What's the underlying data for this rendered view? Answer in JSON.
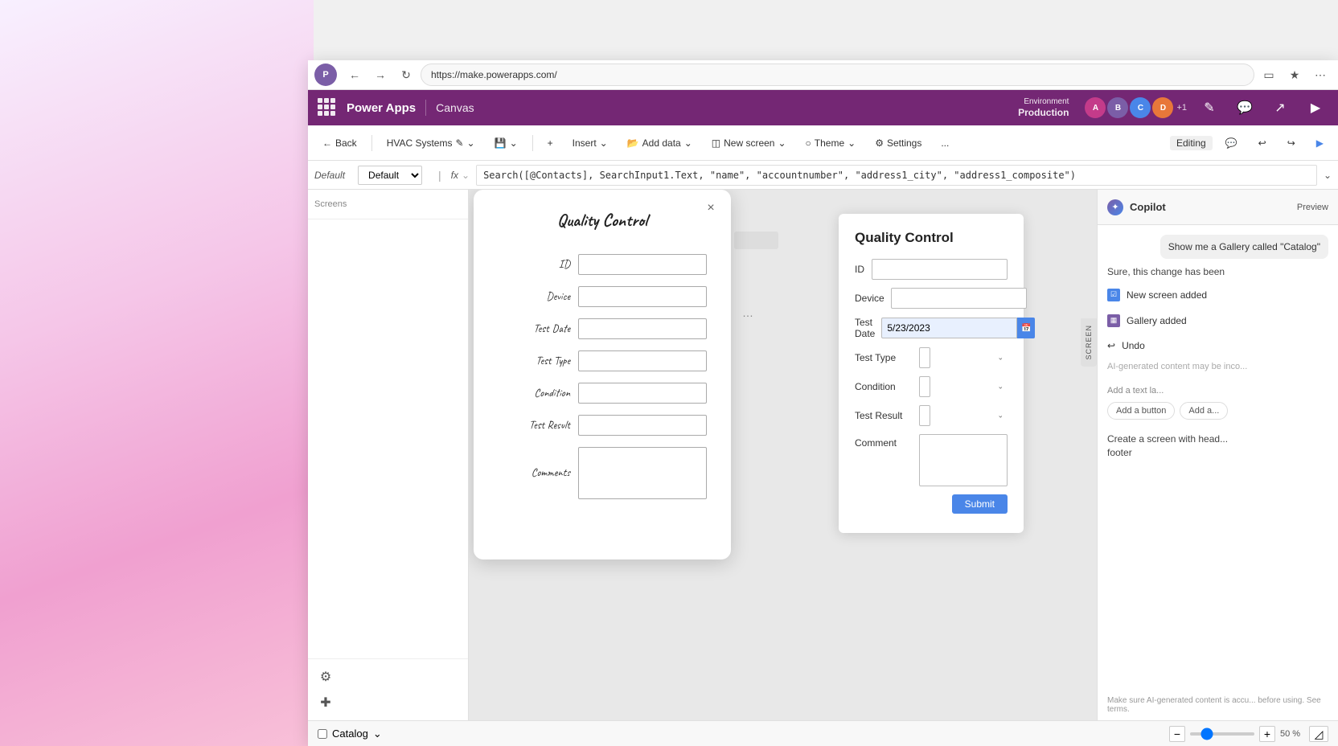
{
  "background": {
    "gradient_description": "pink-purple gradient on left side"
  },
  "browser": {
    "url": "https://make.powerapps.com/"
  },
  "powerapp": {
    "app_name": "Power Apps",
    "section": "Canvas",
    "env_label": "Environment",
    "env_name": "Production"
  },
  "toolbar": {
    "back_label": "Back",
    "app_title": "HVAC Systems",
    "insert_label": "Insert",
    "add_data_label": "Add data",
    "new_screen_label": "New screen",
    "theme_label": "Theme",
    "settings_label": "Settings",
    "more_label": "...",
    "editing_label": "Editing"
  },
  "formula_bar": {
    "fx_label": "fx",
    "formula": "Search([@Contacts], SearchInput1.Text, \"name\", \"accountnumber\", \"address1_city\", \"address1_composite\")"
  },
  "default_dropdown": {
    "value": "Default",
    "options": [
      "Default"
    ]
  },
  "overlay_card": {
    "title": "Quality Control",
    "close_btn": "×",
    "fields": [
      {
        "label": "ID",
        "type": "input"
      },
      {
        "label": "Device",
        "type": "input"
      },
      {
        "label": "Test Date",
        "type": "input"
      },
      {
        "label": "Test Type",
        "type": "input"
      },
      {
        "label": "Condition",
        "type": "input"
      },
      {
        "label": "Test Result",
        "type": "input"
      },
      {
        "label": "Comments",
        "type": "textarea"
      }
    ]
  },
  "qc_card": {
    "title": "Quality Control",
    "fields": [
      {
        "label": "ID",
        "type": "text"
      },
      {
        "label": "Device",
        "type": "text"
      },
      {
        "label": "Test Date",
        "type": "date",
        "value": "5/23/2023"
      },
      {
        "label": "Test Type",
        "type": "select"
      },
      {
        "label": "Condition",
        "type": "select"
      },
      {
        "label": "Test Result",
        "type": "select"
      },
      {
        "label": "Comment",
        "type": "textarea"
      }
    ],
    "submit_label": "Submit"
  },
  "copilot": {
    "title": "Copilot",
    "preview_label": "Preview",
    "bubble": "Show me a Gallery called \"Catalog\"",
    "message": "Sure, this change has been",
    "items": [
      {
        "icon": "☑",
        "label": "New screen added"
      },
      {
        "icon": "▦",
        "label": "Gallery added"
      }
    ],
    "undo_label": "Undo",
    "disclaimer": "AI-generated content may be inco...",
    "suggestions": [
      "Add a text la...",
      "Add a button",
      "Add a..."
    ],
    "create_label": "Create a screen with head...",
    "create_sub": "footer",
    "bottom_disclaimer": "Make sure AI-generated content is accu... before using. See terms."
  },
  "bottom_bar": {
    "catalog_label": "Catalog",
    "zoom_minus": "−",
    "zoom_plus": "+",
    "zoom_level": "50 %",
    "zoom_value": 50
  },
  "screen_tab": {
    "label": "SCREEN"
  }
}
